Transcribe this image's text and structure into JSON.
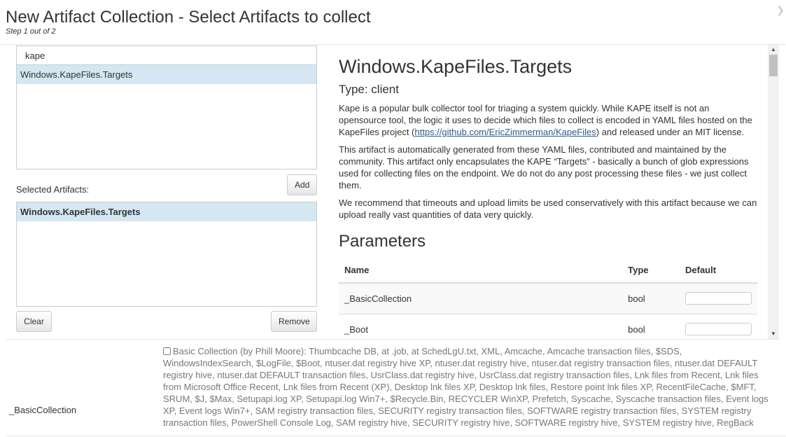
{
  "header": {
    "title": "New Artifact Collection - Select Artifacts to collect",
    "subtitle": "Step 1 out of 2",
    "close_icon": "chevron-right-icon"
  },
  "left": {
    "search_value": "kape",
    "available_items": [
      "Windows.KapeFiles.Targets"
    ],
    "add_label": "Add",
    "selected_label": "Selected Artifacts:",
    "selected_items": [
      "Windows.KapeFiles.Targets"
    ],
    "clear_label": "Clear",
    "remove_label": "Remove"
  },
  "doc": {
    "title": "Windows.KapeFiles.Targets",
    "type": "Type: client",
    "p1_before": "Kape is a popular bulk collector tool for triaging a system quickly. While KAPE itself is not an opensource tool, the logic it uses to decide which files to collect is encoded in YAML files hosted on the KapeFiles project (",
    "p1_link": "https://github.com/EricZimmerman/KapeFiles",
    "p1_after": ") and released under an MIT license.",
    "p2": "This artifact is automatically generated from these YAML files, contributed and maintained by the community. This artifact only encapsulates the KAPE “Targets” - basically a bunch of glob expressions used for collecting files on the endpoint. We do not do any post processing these files - we just collect them.",
    "p3": "We recommend that timeouts and upload limits be used conservatively with this artifact because we can upload really vast quantities of data very quickly.",
    "params_heading": "Parameters",
    "columns": {
      "name": "Name",
      "type": "Type",
      "default": "Default"
    },
    "params": [
      {
        "name": "_BasicCollection",
        "type": "bool",
        "default": ""
      },
      {
        "name": "_Boot",
        "type": "bool",
        "default": ""
      }
    ]
  },
  "bottom": {
    "param_name": "_BasicCollection",
    "description": "Basic Collection (by Phill Moore): Thumbcache DB, at .job, at SchedLgU.txt, XML, Amcache, Amcache transaction files, $SDS, WindowsIndexSearch, $LogFile, $Boot, ntuser.dat registry hive XP, ntuser.dat registry hive, ntuser.dat registry transaction files, ntuser.dat DEFAULT registry hive, ntuser.dat DEFAULT transaction files, UsrClass.dat registry hive, UsrClass.dat registry transaction files, Lnk files from Recent, Lnk files from Microsoft Office Recent, Lnk files from Recent (XP), Desktop lnk files XP, Desktop lnk files, Restore point lnk files XP, RecentFileCache, $MFT, SRUM, $J, $Max, Setupapi.log XP, Setupapi.log Win7+, $Recycle.Bin, RECYCLER WinXP, Prefetch, Syscache, Syscache transaction files, Event logs XP, Event logs Win7+, SAM registry transaction files, SECURITY registry transaction files, SOFTWARE registry transaction files, SYSTEM registry transaction files, PowerShell Console Log, SAM registry hive, SECURITY registry hive, SOFTWARE registry hive, SYSTEM registry hive, RegBack"
  }
}
